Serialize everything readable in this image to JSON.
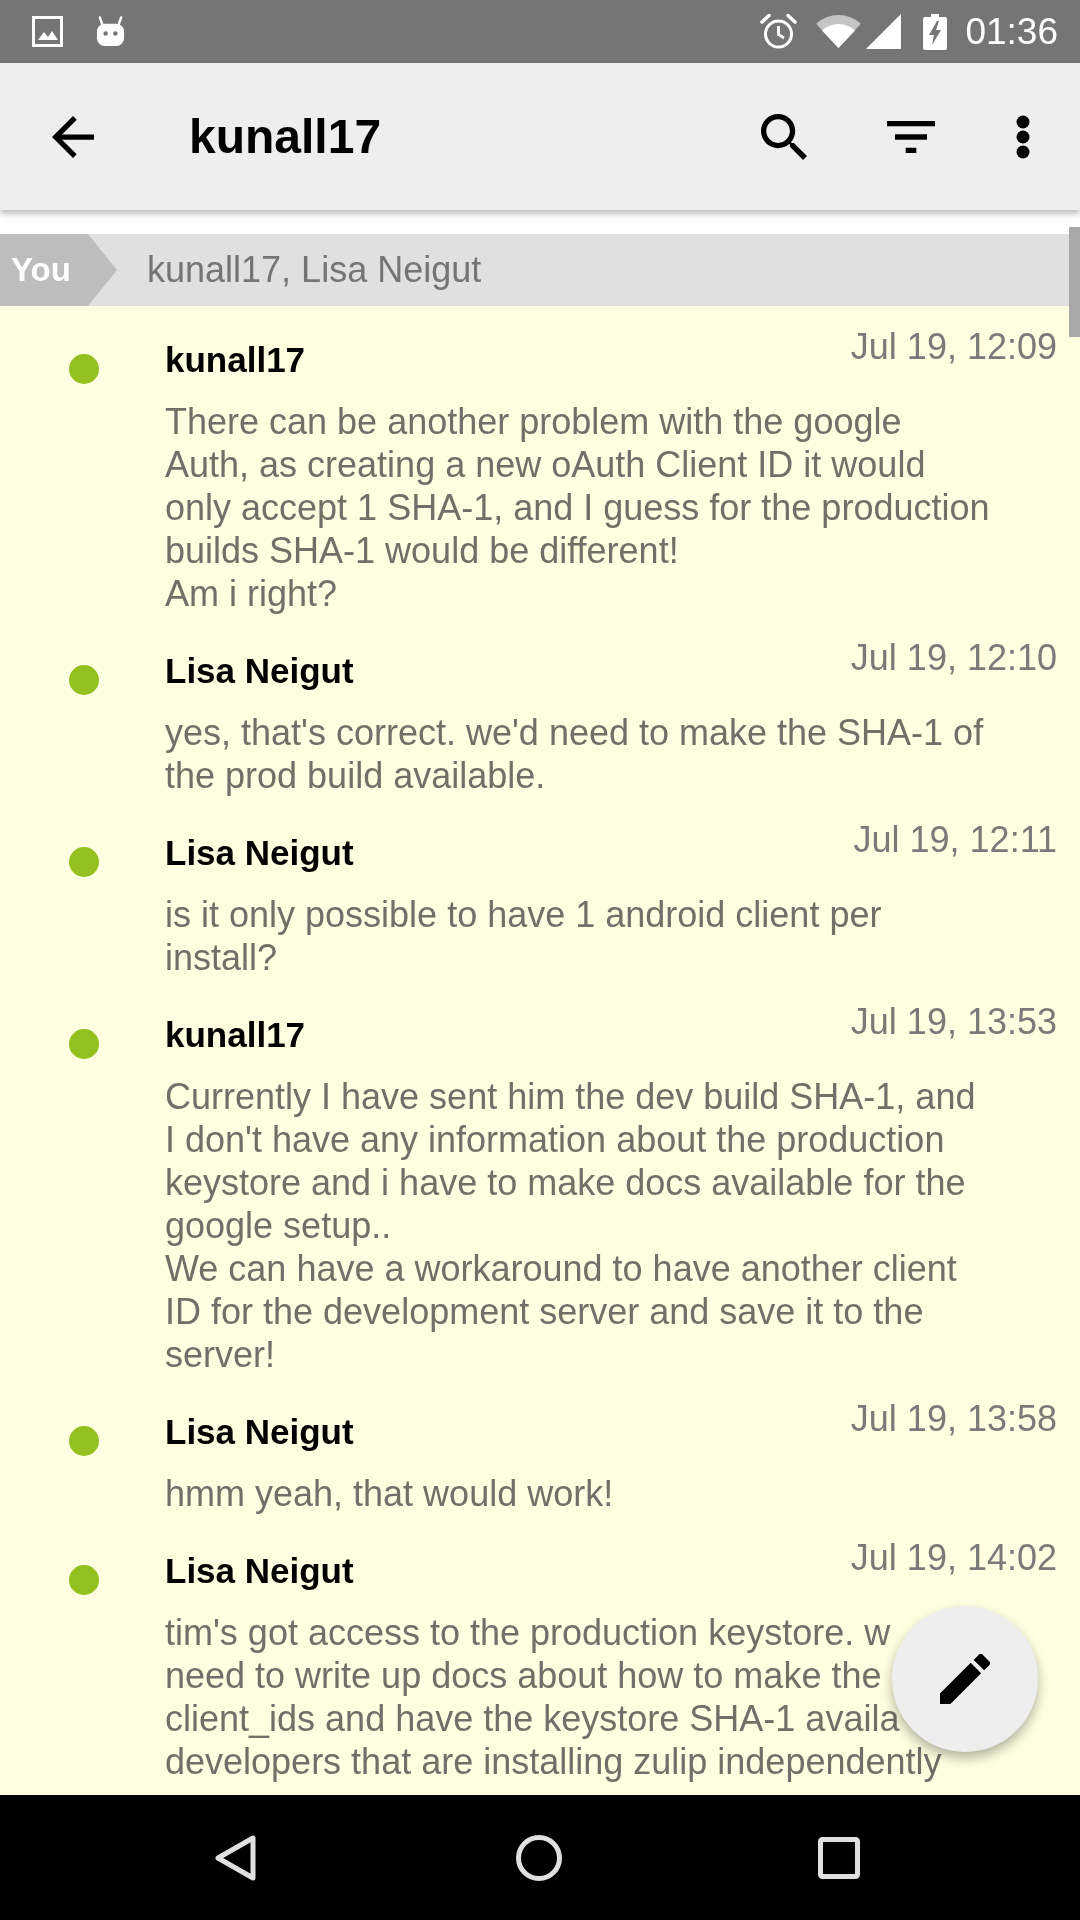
{
  "status_bar": {
    "time": "01:36"
  },
  "app_bar": {
    "title": "kunall17"
  },
  "recipient_bar": {
    "tag": "You",
    "recipients": "kunall17, Lisa Neigut"
  },
  "messages": [
    {
      "sender": "kunall17",
      "time": "Jul 19, 12:09",
      "text": "There can be another problem with the google\nAuth, as creating a new oAuth Client ID it would\nonly accept 1 SHA-1, and I guess for the production\nbuilds SHA-1 would be different!\nAm i right?"
    },
    {
      "sender": "Lisa Neigut",
      "time": "Jul 19, 12:10",
      "text": "yes, that's correct. we'd need to make the SHA-1 of\nthe prod build available."
    },
    {
      "sender": "Lisa Neigut",
      "time": "Jul 19, 12:11",
      "text": "is it only possible to have 1 android client per\ninstall?"
    },
    {
      "sender": "kunall17",
      "time": "Jul 19, 13:53",
      "text": "Currently I have sent him the dev build SHA-1, and\nI don't have any information about the production\nkeystore and i have to make docs available for the\ngoogle setup..\nWe can have a workaround to have another client\nID for the development server and save it to the\nserver!"
    },
    {
      "sender": "Lisa Neigut",
      "time": "Jul 19, 13:58",
      "text": "hmm yeah, that would work!"
    },
    {
      "sender": "Lisa Neigut",
      "time": "Jul 19, 14:02",
      "text": "tim's got access to the production keystore. w\nneed to write up docs about how to make the\nclient_ids and have the keystore SHA-1 availa\ndevelopers that are installing zulip independently"
    }
  ]
}
